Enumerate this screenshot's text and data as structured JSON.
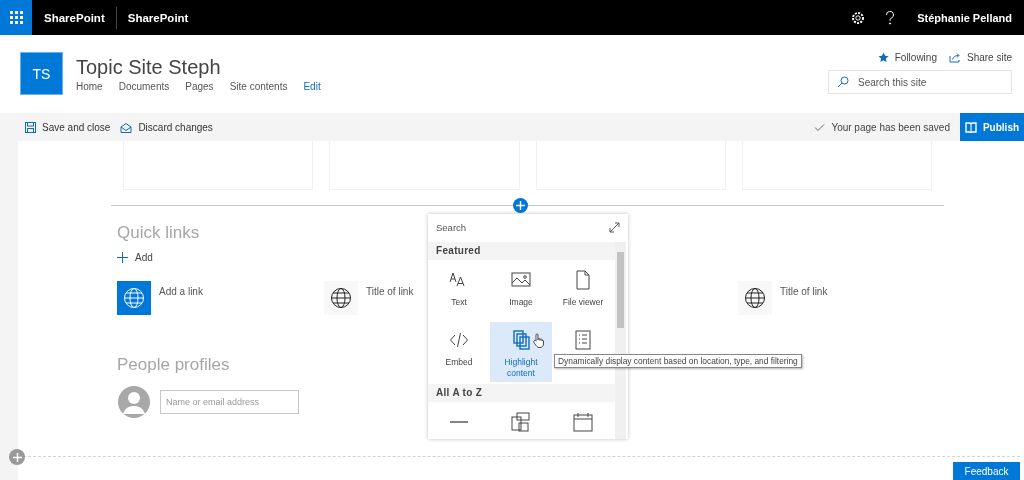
{
  "suite_bar": {
    "app_name": "SharePoint",
    "site_name": "SharePoint",
    "user": "Stéphanie Pelland"
  },
  "site_header": {
    "logo": "TS",
    "title": "Topic Site Steph",
    "nav": [
      {
        "label": "Home",
        "kind": "page"
      },
      {
        "label": "Documents",
        "kind": "page"
      },
      {
        "label": "Pages",
        "kind": "page"
      },
      {
        "label": "Site contents",
        "kind": "page"
      },
      {
        "label": "Edit",
        "kind": "action"
      }
    ],
    "following": "Following",
    "share": "Share site",
    "search": {
      "placeholder": "Search this site"
    }
  },
  "command_bar": {
    "buttons": [
      {
        "label": "Save and close",
        "kind": "save"
      },
      {
        "label": "Discard changes",
        "kind": "discard"
      }
    ],
    "status": "Your page has been saved",
    "publish": "Publish"
  },
  "quick_links": {
    "title": "Quick links",
    "add": "Add",
    "links": [
      {
        "title": "Add a link",
        "kind": "new"
      },
      {
        "title": "Title of link",
        "kind": "existing"
      },
      {
        "title": "Title of link",
        "kind": "existing"
      }
    ]
  },
  "people": {
    "title": "People profiles",
    "placeholder": "Name or email address"
  },
  "toolbox": {
    "search_placeholder": "Search",
    "sections": [
      {
        "title": "Featured",
        "items": [
          {
            "label": "Text",
            "kind": "text",
            "selected": false
          },
          {
            "label": "Image",
            "kind": "image",
            "selected": false
          },
          {
            "label": "File viewer",
            "kind": "file",
            "selected": false
          },
          {
            "label": "Embed",
            "kind": "embed",
            "selected": false
          },
          {
            "label": "Highlight content",
            "kind": "highlight",
            "selected": true
          },
          {
            "kind": "list",
            "selected": false
          }
        ]
      },
      {
        "title": "All A to Z",
        "items": [
          {
            "kind": "divider",
            "selected": false
          },
          {
            "kind": "shapes",
            "selected": false
          },
          {
            "kind": "calendar",
            "selected": false
          }
        ]
      }
    ]
  },
  "tooltip": "Dynamically display content based on location, type, and filtering",
  "feedback": "Feedback"
}
